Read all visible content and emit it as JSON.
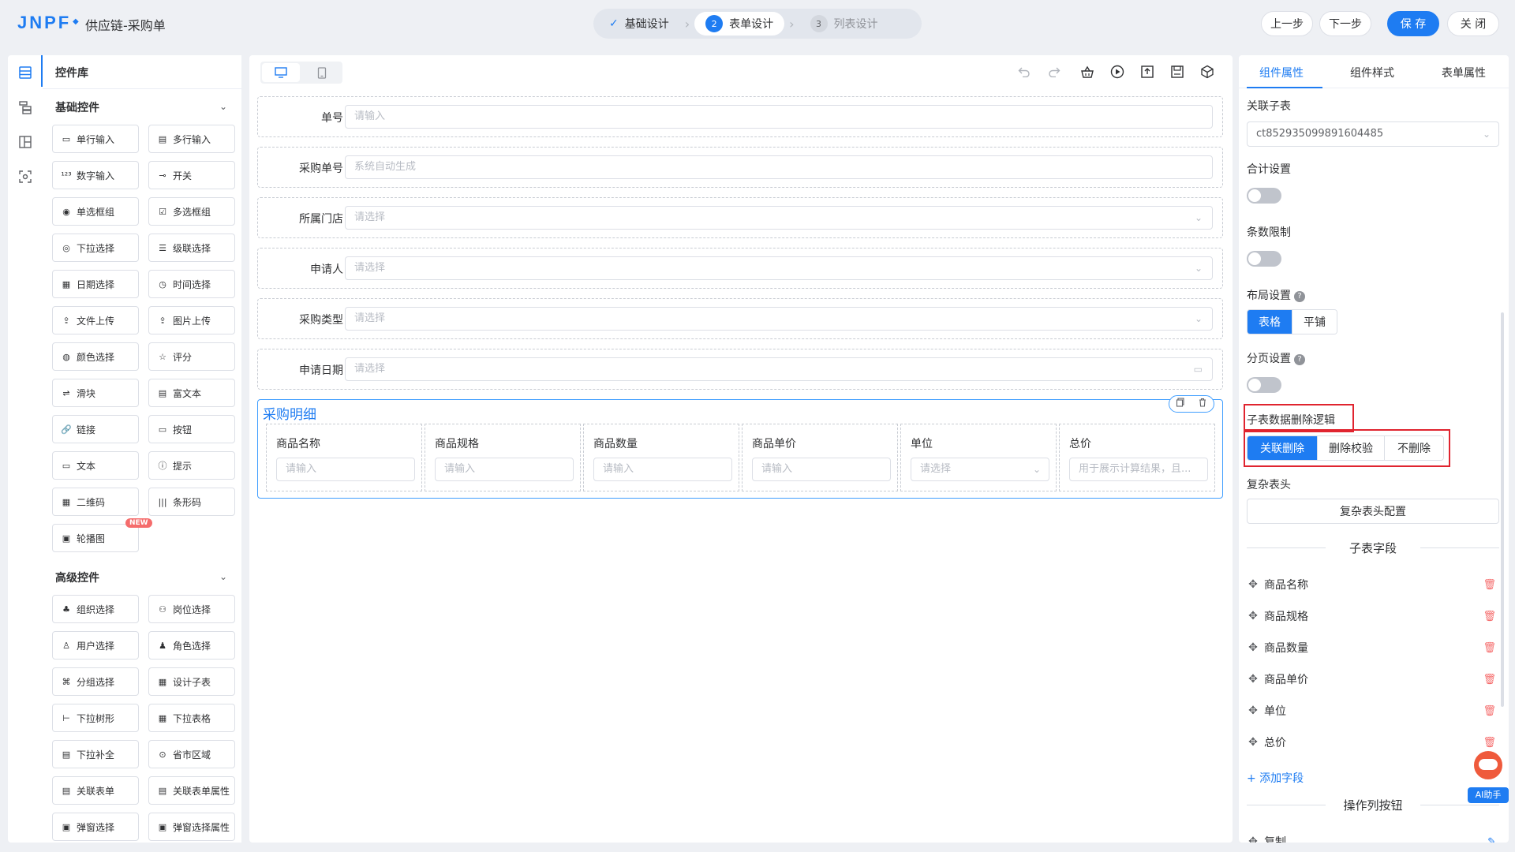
{
  "header": {
    "logo": "JNPF",
    "app_title": "供应链-采购单",
    "steps": [
      {
        "label": "基础设计",
        "state": "done",
        "num": ""
      },
      {
        "label": "表单设计",
        "state": "active",
        "num": "2"
      },
      {
        "label": "列表设计",
        "state": "todo",
        "num": "3"
      }
    ],
    "buttons": {
      "prev": "上一步",
      "next": "下一步",
      "save": "保 存",
      "close": "关 闭"
    }
  },
  "library": {
    "title": "控件库",
    "basic_title": "基础控件",
    "basic": [
      "单行输入",
      "多行输入",
      "数字输入",
      "开关",
      "单选框组",
      "多选框组",
      "下拉选择",
      "级联选择",
      "日期选择",
      "时间选择",
      "文件上传",
      "图片上传",
      "颜色选择",
      "评分",
      "滑块",
      "富文本",
      "链接",
      "按钮",
      "文本",
      "提示",
      "二维码",
      "条形码",
      "轮播图"
    ],
    "new_badge": "NEW",
    "advanced_title": "高级控件",
    "advanced": [
      "组织选择",
      "岗位选择",
      "用户选择",
      "角色选择",
      "分组选择",
      "设计子表",
      "下拉树形",
      "下拉表格",
      "下拉补全",
      "省市区域",
      "关联表单",
      "关联表单属性",
      "弹窗选择",
      "弹窗选择属性"
    ]
  },
  "form": {
    "fields": [
      {
        "label": "单号",
        "placeholder": "请输入",
        "suffix": ""
      },
      {
        "label": "采购单号",
        "placeholder": "系统自动生成",
        "suffix": ""
      },
      {
        "label": "所属门店",
        "placeholder": "请选择",
        "suffix": "⌄"
      },
      {
        "label": "申请人",
        "placeholder": "请选择",
        "suffix": "⌄"
      },
      {
        "label": "采购类型",
        "placeholder": "请选择",
        "suffix": "⌄"
      },
      {
        "label": "申请日期",
        "placeholder": "请选择",
        "suffix": "▭"
      }
    ],
    "subtable": {
      "title": "采购明细",
      "columns": [
        {
          "label": "商品名称",
          "placeholder": "请输入",
          "suffix": ""
        },
        {
          "label": "商品规格",
          "placeholder": "请输入",
          "suffix": ""
        },
        {
          "label": "商品数量",
          "placeholder": "请输入",
          "suffix": ""
        },
        {
          "label": "商品单价",
          "placeholder": "请输入",
          "suffix": ""
        },
        {
          "label": "单位",
          "placeholder": "请选择",
          "suffix": "⌄"
        },
        {
          "label": "总价",
          "placeholder": "用于展示计算结果，且...",
          "suffix": ""
        }
      ]
    }
  },
  "props": {
    "tabs": [
      "组件属性",
      "组件样式",
      "表单属性"
    ],
    "related_table_label": "关联子表",
    "related_table_value": "ct852935099891604485",
    "sum_label": "合计设置",
    "limit_label": "条数限制",
    "layout_label": "布局设置",
    "layout_options": [
      "表格",
      "平铺"
    ],
    "paging_label": "分页设置",
    "delete_logic_label": "子表数据删除逻辑",
    "delete_options": [
      "关联删除",
      "删除校验",
      "不删除"
    ],
    "complex_header_label": "复杂表头",
    "complex_header_button": "复杂表头配置",
    "subfields_title": "子表字段",
    "subfields": [
      "商品名称",
      "商品规格",
      "商品数量",
      "商品单价",
      "单位",
      "总价"
    ],
    "add_field": "+ 添加字段",
    "op_buttons_title": "操作列按钮",
    "op_first": "复制",
    "help_glyph": "?"
  },
  "ai": {
    "label": "AI助手"
  },
  "colors": {
    "primary": "#1e7cf2",
    "danger": "#e0242f"
  }
}
